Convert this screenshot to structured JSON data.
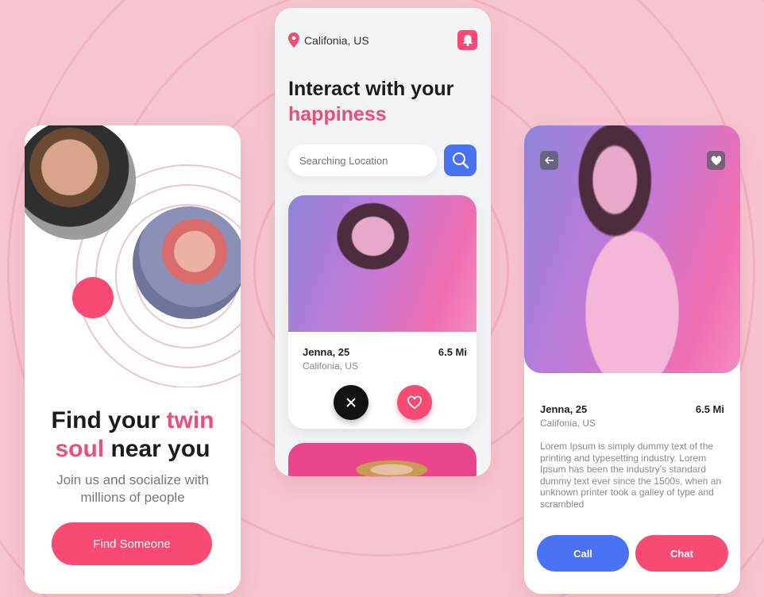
{
  "colors": {
    "pink": "#f84a73",
    "blue": "#4a72f5",
    "background": "#f6c6d0"
  },
  "onboarding": {
    "title_part1": "Find your ",
    "title_highlight": "twin",
    "title_part2_highlight": "soul",
    "title_part2": " near you",
    "subtitle_line1": "Join us and socialize with",
    "subtitle_line2": "millions of people",
    "cta_label": "Find Someone"
  },
  "home": {
    "location": "Califonia, US",
    "title_line1": "Interact with your",
    "title_highlight": "happiness",
    "search_placeholder": "Searching Location",
    "profile_card": {
      "name": "Jenna, 25",
      "distance": "6.5 Mi",
      "location": "Califonia, US"
    },
    "icons": [
      "map-pin-icon",
      "bell-icon",
      "search-icon",
      "close-icon",
      "heart-icon"
    ]
  },
  "profile": {
    "name": "Jenna, 25",
    "distance": "6.5 Mi",
    "location": "Califonia, US",
    "bio": "Lorem Ipsum is simply dummy text of the printing and typesetting industry. Lorem Ipsum has been the industry's standard dummy text ever since the 1500s, when an unknown printer took a galley of type and scrambled",
    "call_label": "Call",
    "chat_label": "Chat",
    "icons": [
      "back-arrow-icon",
      "heart-icon"
    ]
  }
}
